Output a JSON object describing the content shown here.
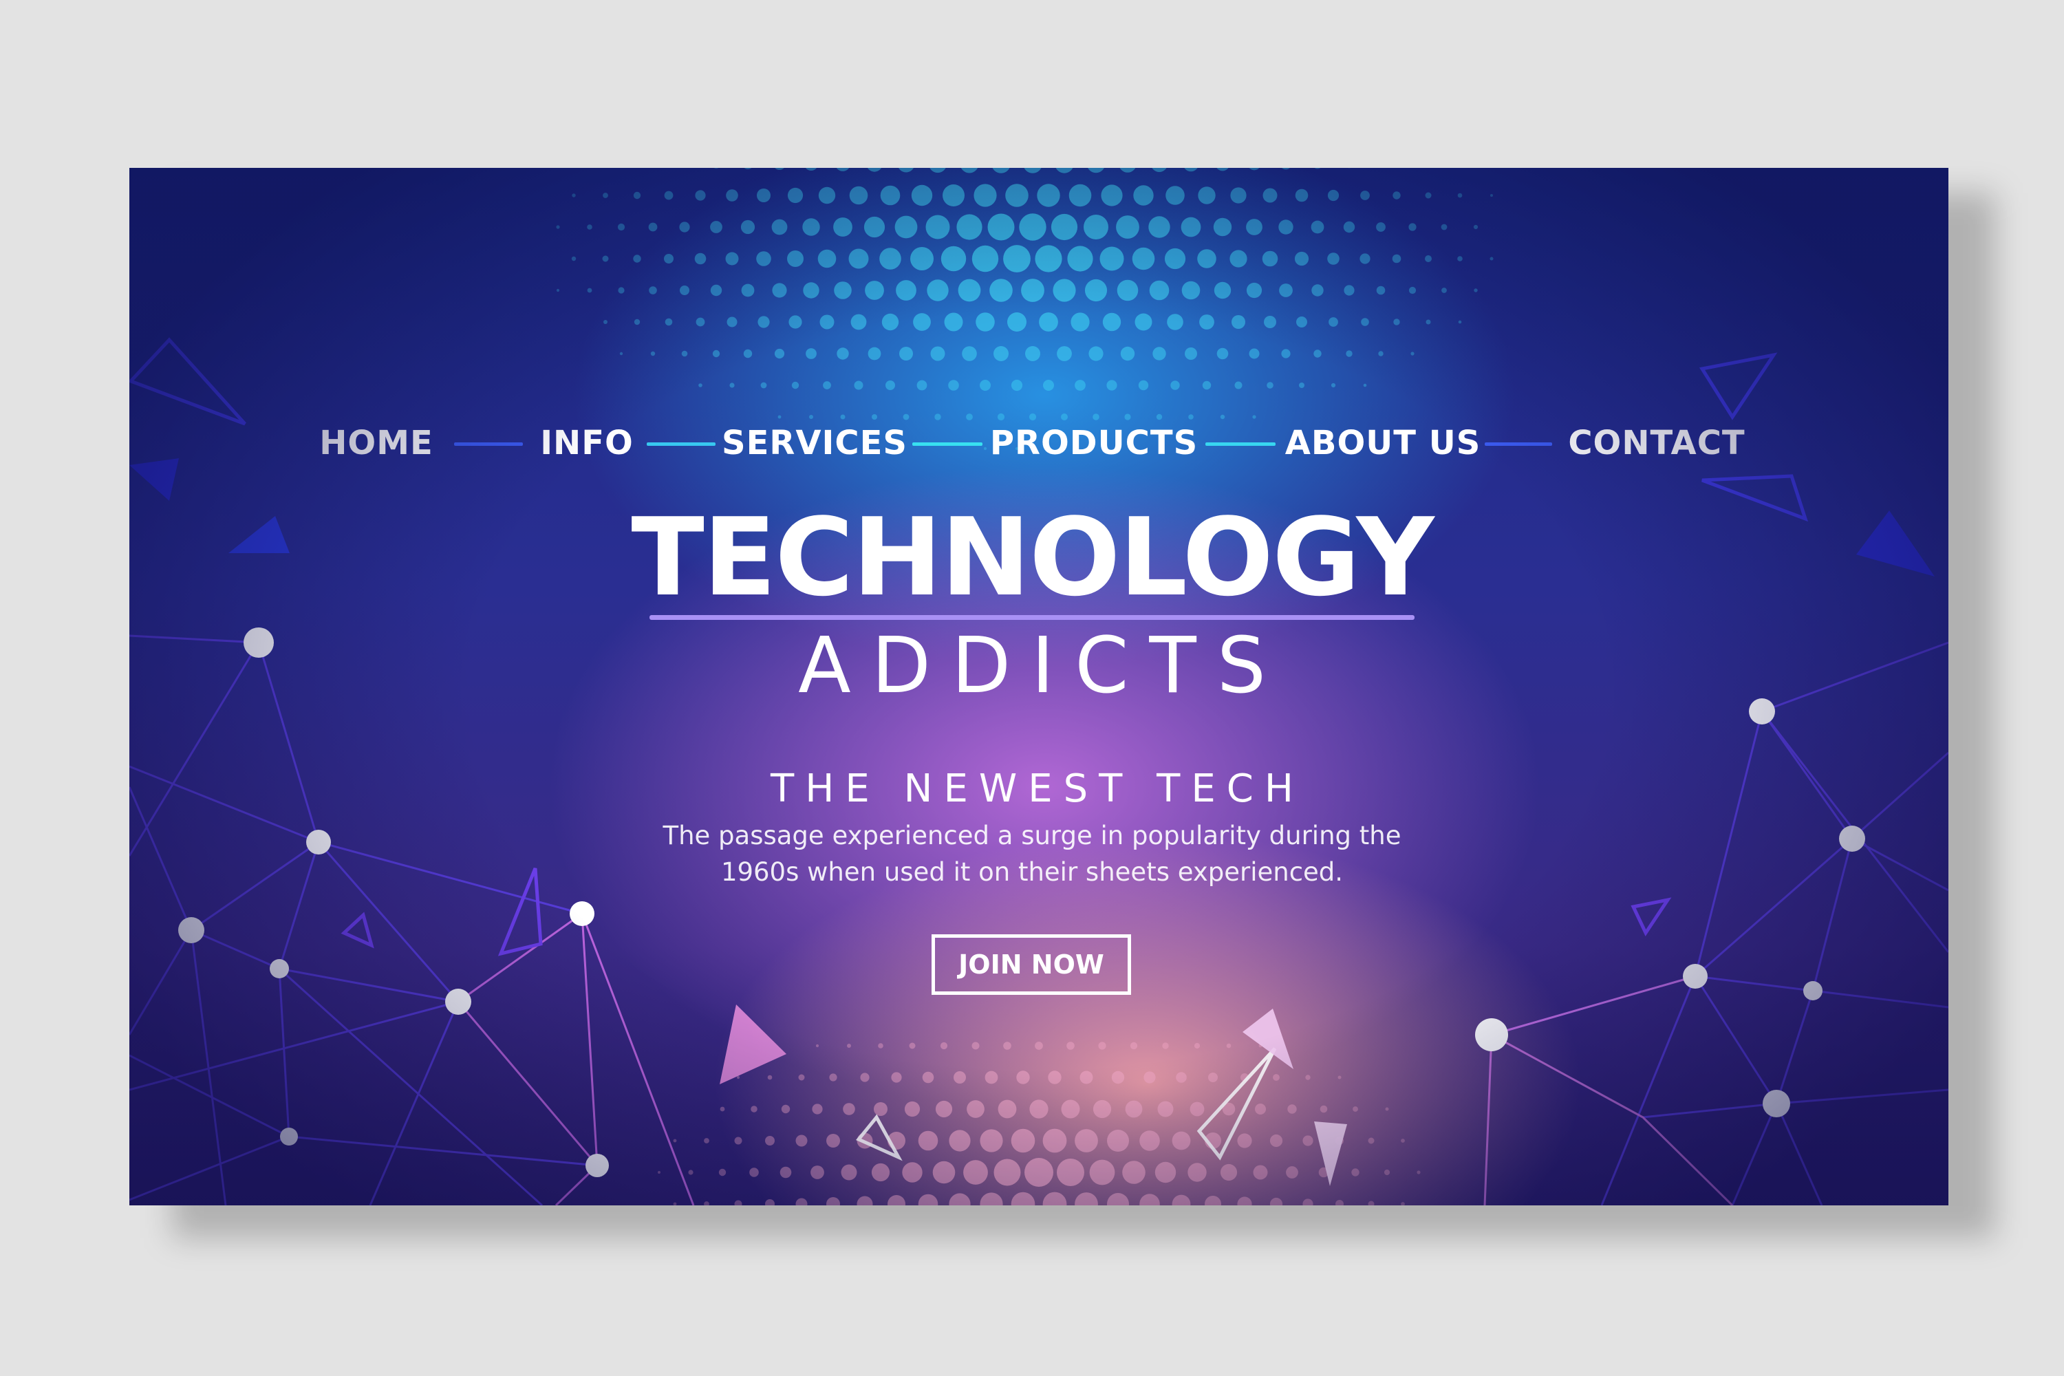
{
  "nav": {
    "items": [
      {
        "label": "HOME"
      },
      {
        "label": "INFO"
      },
      {
        "label": "SERVICES"
      },
      {
        "label": "PRODUCTS"
      },
      {
        "label": "ABOUT US"
      },
      {
        "label": "CONTACT"
      }
    ]
  },
  "hero": {
    "title": "TECHNOLOGY",
    "subtitle": "ADDICTS",
    "tagline": "THE NEWEST TECH",
    "description": "The passage experienced a surge in popularity during the 1960s when used it on their sheets experienced.",
    "cta_label": "JOIN NOW"
  },
  "colors": {
    "accent_blue": "#3b5bf0",
    "accent_cyan": "#38d6f0",
    "title_rule": "#a991f5",
    "network_lines": "#5a3ee0",
    "network_lines_pink": "#d77ae8"
  }
}
